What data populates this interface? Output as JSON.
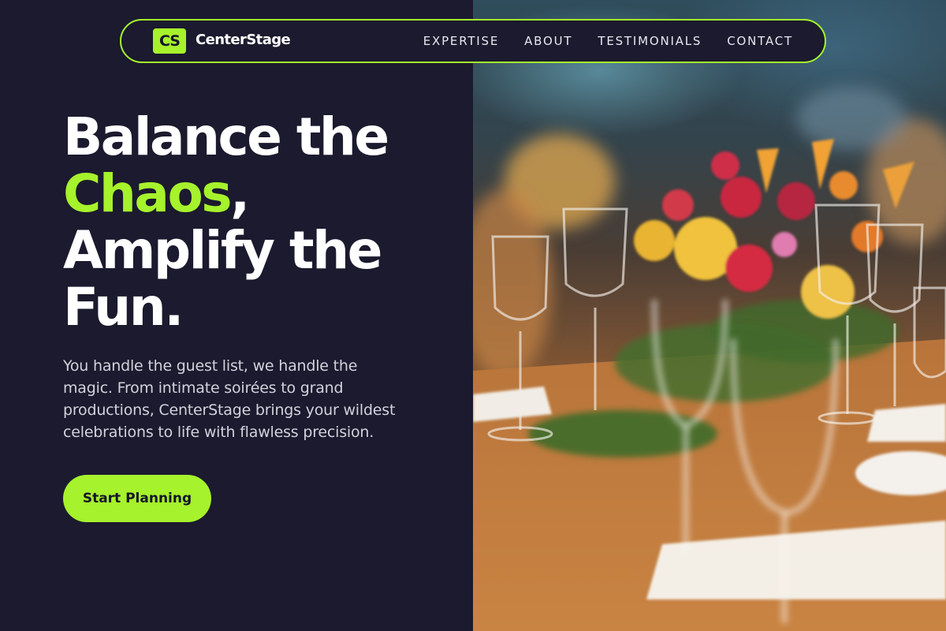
{
  "brand": {
    "logo_mark": "CS",
    "name": "CenterStage",
    "accent_color": "#a6f22c",
    "background_color": "#1b1a2e"
  },
  "nav": {
    "items": [
      {
        "label": "EXPERTISE"
      },
      {
        "label": "ABOUT"
      },
      {
        "label": "TESTIMONIALS"
      },
      {
        "label": "CONTACT"
      }
    ]
  },
  "hero": {
    "headline_line1": "Balance the",
    "headline_accent": "Chaos",
    "headline_comma": ",",
    "headline_line3": "Amplify the",
    "headline_line4": "Fun.",
    "lead": "You handle the guest list, we handle the magic. From intimate soirées to grand productions, CenterStage brings your wildest celebrations to life with flawless precision.",
    "cta_label": "Start Planning",
    "image_subject": "event-table-floral-centerpiece-photo"
  }
}
